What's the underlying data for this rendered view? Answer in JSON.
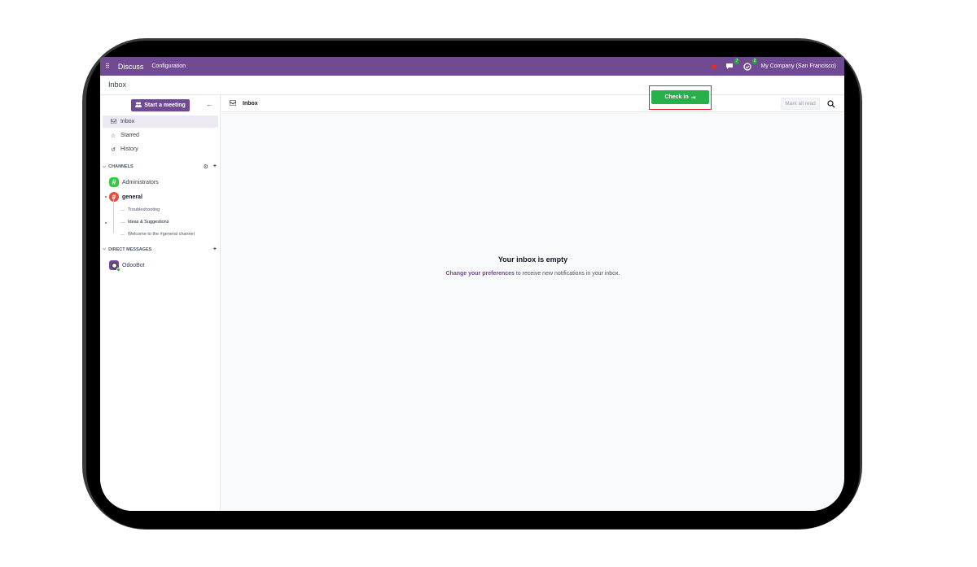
{
  "navbar": {
    "app_name": "Discuss",
    "menu": [
      "Configuration"
    ],
    "messages_badge": "7",
    "activities_badge": "2",
    "company": "My Company (San Francisco)"
  },
  "control_panel": {
    "breadcrumb": "Inbox",
    "checkin_label": "Check in"
  },
  "sidebar": {
    "start_meeting_label": "Start a meeting",
    "mailboxes": [
      {
        "label": "Inbox",
        "icon": "inbox-icon",
        "active": true
      },
      {
        "label": "Starred",
        "icon": "star-icon",
        "active": false
      },
      {
        "label": "History",
        "icon": "history-icon",
        "active": false
      }
    ],
    "channels_header": "CHANNELS",
    "channels": [
      {
        "label": "Administrators",
        "color": "#2ecc40"
      },
      {
        "label": "general",
        "color": "#e14c3c"
      }
    ],
    "threads": [
      "Troubleshooting",
      "Ideas & Suggestions",
      "Welcome to the #general channel"
    ],
    "dm_header": "DIRECT MESSAGES",
    "direct_messages": [
      {
        "label": "OdooBot"
      }
    ]
  },
  "thread": {
    "title": "Inbox",
    "mark_all_read": "Mark all read"
  },
  "empty_state": {
    "title": "Your inbox is empty",
    "link_text": "Change your preferences",
    "rest_text": " to receive new notifications in your inbox."
  },
  "colors": {
    "brand": "#714b91",
    "checkin": "#28b04a",
    "highlight": "#e0202a"
  }
}
